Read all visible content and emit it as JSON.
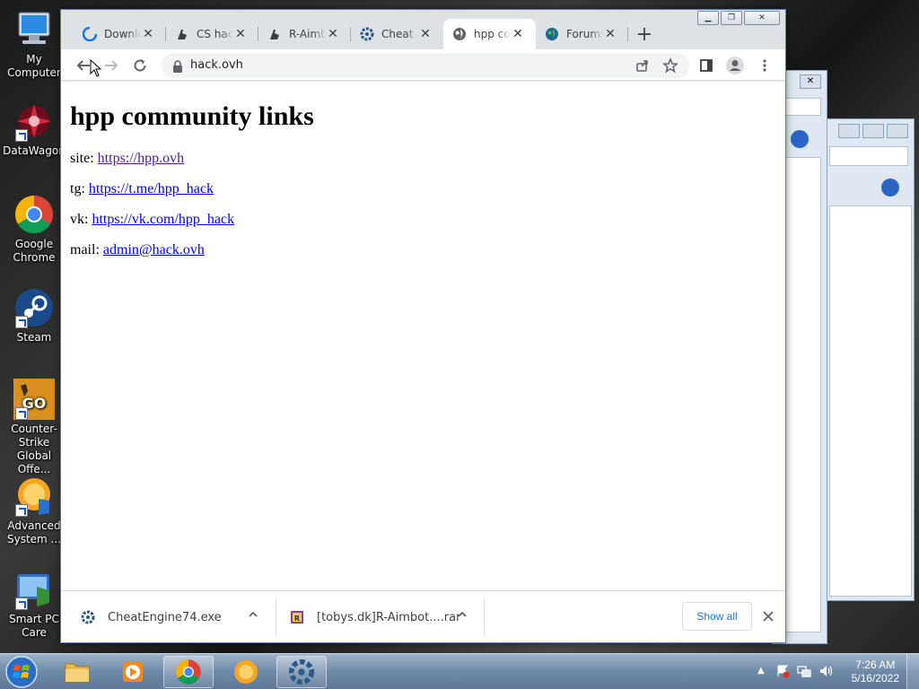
{
  "desktop": {
    "icons": [
      {
        "label": "My Computer",
        "icon": "computer-icon"
      },
      {
        "label": "DataWagon",
        "icon": "datawagon-icon"
      },
      {
        "label": "Google Chrome",
        "icon": "chrome-icon"
      },
      {
        "label": "Steam",
        "icon": "steam-icon"
      },
      {
        "label": "Counter-Strike Global Offe...",
        "icon": "csgo-icon"
      },
      {
        "label": "Advanced System ...",
        "icon": "advanced-systemcare-icon"
      },
      {
        "label": "Smart PC Care",
        "icon": "smart-pc-care-icon"
      }
    ]
  },
  "browser": {
    "tabs": [
      {
        "title": "Downloads",
        "icon": "download-icon",
        "active": false
      },
      {
        "title": "CS hacks",
        "icon": "cs-icon",
        "active": false
      },
      {
        "title": "R-Aimbot",
        "icon": "cs-icon",
        "active": false
      },
      {
        "title": "Cheat Engine",
        "icon": "cheat-engine-icon",
        "active": false
      },
      {
        "title": "hpp community links",
        "icon": "globe-icon",
        "active": true
      },
      {
        "title": "Forums",
        "icon": "globe-icon",
        "active": false
      }
    ],
    "address": "hack.ovh"
  },
  "page": {
    "heading": "hpp community links",
    "links": [
      {
        "label": "site: ",
        "url": "https://hpp.ovh",
        "visited": true
      },
      {
        "label": "tg: ",
        "url": "https://t.me/hpp_hack",
        "visited": false
      },
      {
        "label": "vk: ",
        "url": "https://vk.com/hpp_hack",
        "visited": false
      },
      {
        "label": "mail: ",
        "url": "admin@hack.ovh",
        "visited": false
      }
    ]
  },
  "downloads": {
    "items": [
      {
        "name": "CheatEngine74.exe",
        "icon": "cheat-engine-icon"
      },
      {
        "name": "[tobys.dk]R-Aimbot....rar",
        "icon": "rar-icon"
      }
    ],
    "show_all": "Show all"
  },
  "taskbar": {
    "time": "7:26 AM",
    "date": "5/16/2022"
  }
}
